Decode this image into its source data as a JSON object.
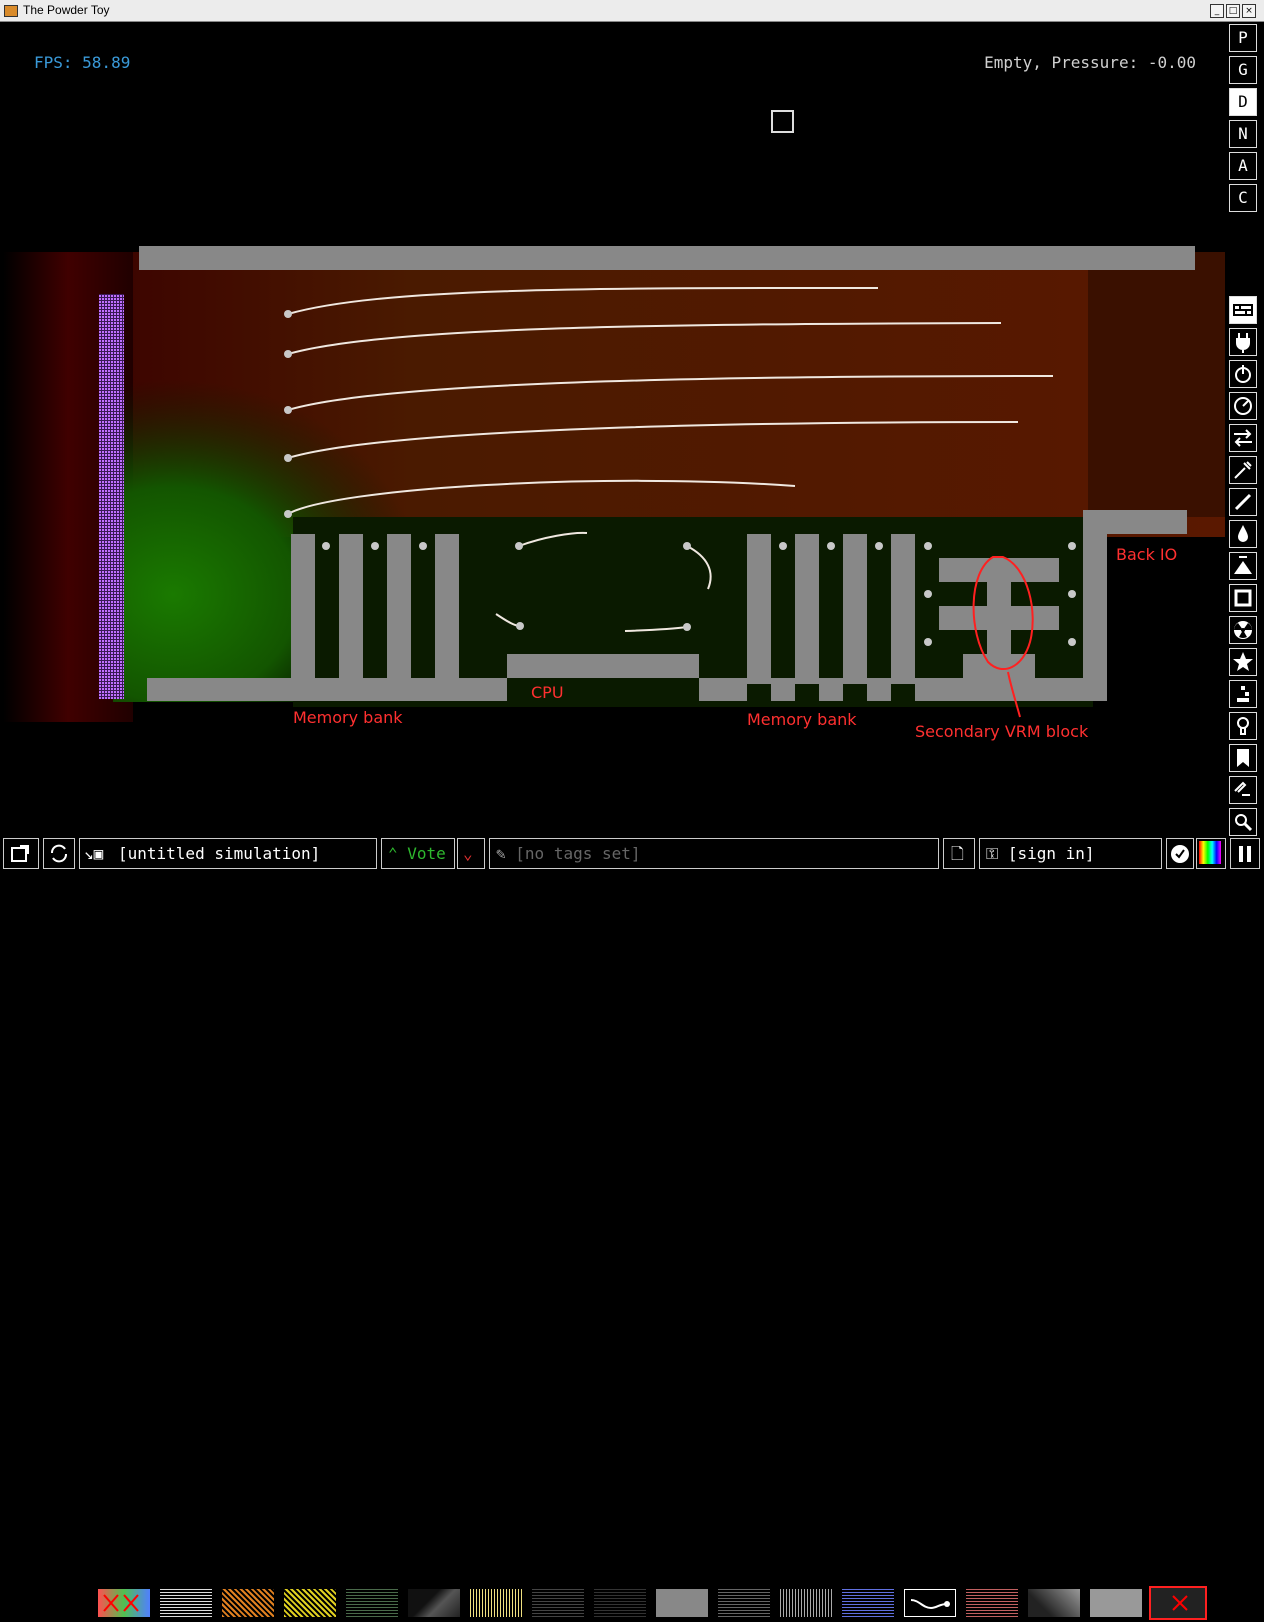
{
  "window": {
    "title": "The Powder Toy"
  },
  "hud": {
    "fps": "FPS: 58.89",
    "status": "Empty, Pressure: -0.00"
  },
  "annotations": {
    "memory_bank_left": "Memory bank",
    "cpu": "CPU",
    "memory_bank_right": "Memory bank",
    "secondary_vrm": "Secondary VRM block",
    "back_io": "Back IO"
  },
  "menu_buttons": [
    "P",
    "G",
    "D",
    "N",
    "A",
    "C"
  ],
  "menu_selected": "D",
  "categories": [
    "walls-icon",
    "electronics-icon",
    "powered-icon",
    "sensors-icon",
    "force-icon",
    "explosives-icon",
    "gases-icon",
    "liquids-icon",
    "powders-icon",
    "solids-icon",
    "radioactive-icon",
    "special-icon",
    "life-icon",
    "tools-icon",
    "favorites-icon",
    "deco-icon",
    "search-icon"
  ],
  "bottom": {
    "save_name": "[untitled simulation]",
    "vote": "Vote",
    "tags": "[no tags set]",
    "sign_in": "[sign in]"
  },
  "colors": {
    "annotation": "#ff3030",
    "fps": "#3a9ad9",
    "vote": "#2eb82e",
    "wall": "#888888"
  }
}
